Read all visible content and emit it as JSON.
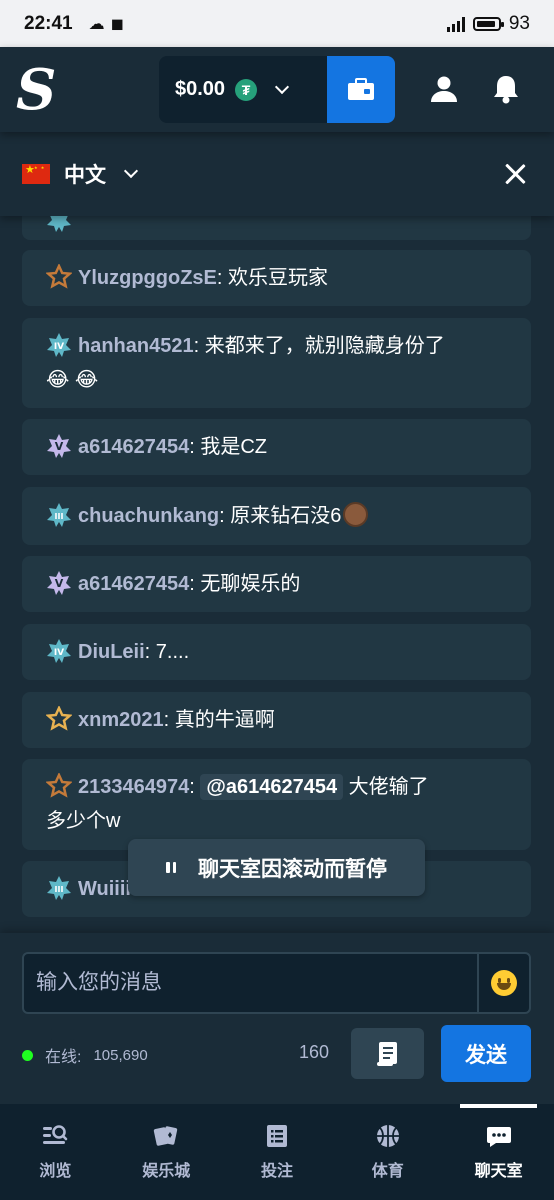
{
  "status_bar": {
    "time": "22:41",
    "network": "5G",
    "battery": "93"
  },
  "header": {
    "logo": "S",
    "balance": "$0.00",
    "currency_icon": "tether-icon",
    "icons": [
      "wallet-icon",
      "user-icon",
      "bell-icon"
    ]
  },
  "chat": {
    "language": "中文",
    "messages": [
      {
        "user": "",
        "text": "",
        "badge": "platinum-iv"
      },
      {
        "user": "YluzgpggoZsE",
        "text": "欢乐豆玩家",
        "badge": "bronze"
      },
      {
        "user": "hanhan4521",
        "text": "来都来了，就别隐藏身份了",
        "emoji": "😂 😂",
        "badge": "platinum-iv"
      },
      {
        "user": "a614627454",
        "text": "我是CZ",
        "badge": "platinum-v"
      },
      {
        "user": "chuachunkang",
        "text": "原来钻石没6",
        "badge": "platinum-iii"
      },
      {
        "user": "a614627454",
        "text": "无聊娱乐的",
        "badge": "platinum-v"
      },
      {
        "user": "DiuLeii",
        "text": "7....",
        "badge": "platinum-iv"
      },
      {
        "user": "xnm2021",
        "text": "真的牛逼啊",
        "badge": "gold"
      },
      {
        "user": "2133464974",
        "mention": "@a614627454",
        "text_after": "大佬输了",
        "text_line2": "多少个w",
        "badge": "bronze"
      },
      {
        "user": "Wuiiii",
        "text": "",
        "badge": "platinum-iii"
      }
    ],
    "paused_notice": "聊天室因滚动而暂停"
  },
  "composer": {
    "placeholder": "输入您的消息",
    "online_label": "在线:",
    "online_count": "105,690",
    "char_count": "160",
    "send_label": "发送"
  },
  "bottom_nav": [
    {
      "label": "浏览",
      "icon": "browse-icon"
    },
    {
      "label": "娱乐城",
      "icon": "casino-cards-icon"
    },
    {
      "label": "投注",
      "icon": "bet-slip-icon"
    },
    {
      "label": "体育",
      "icon": "basketball-icon"
    },
    {
      "label": "聊天室",
      "icon": "chat-icon",
      "active": true
    }
  ],
  "colors": {
    "bg": "#1a2c38",
    "card": "#213743",
    "accent": "#1475e1",
    "dark": "#0f212e"
  }
}
